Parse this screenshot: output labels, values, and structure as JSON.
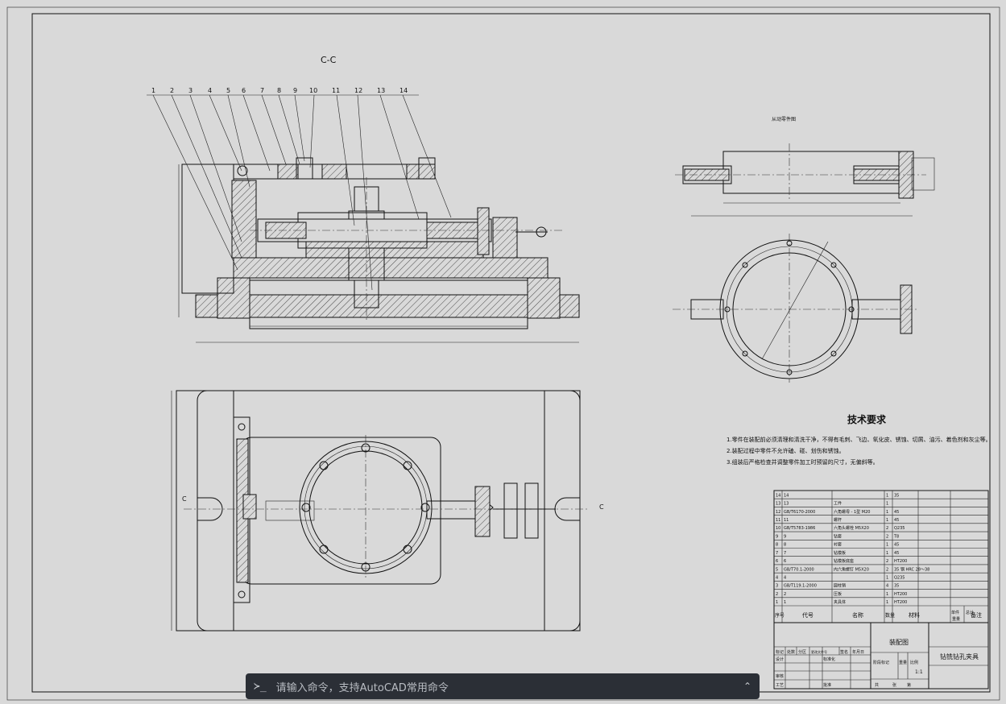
{
  "drawing": {
    "section_label": "C-C",
    "aux_view_label": "从动零件图",
    "tech_req_title": "技术要求",
    "tech_req_lines": [
      "1.零件在装配前必须清理和清洗干净，不得有毛刺、飞边、氧化皮、锈蚀、切屑、油污、着色剂和灰尘等。",
      "2.装配过程中零件不允许磕、碰、划伤和锈蚀。",
      "3.组装后严格检查并调整零件加工时预留的尺寸，无偏斜等。"
    ],
    "balloons": [
      "1",
      "2",
      "3",
      "4",
      "5",
      "6",
      "7",
      "8",
      "9",
      "10",
      "11",
      "12",
      "13",
      "14"
    ],
    "section_marks": [
      "C",
      "C"
    ]
  },
  "bom": {
    "rows": [
      {
        "no": "14",
        "code": "14",
        "name": "",
        "qty": "1",
        "material": "35"
      },
      {
        "no": "13",
        "code": "13",
        "name": "工件",
        "qty": "1",
        "material": ""
      },
      {
        "no": "12",
        "code": "GB/T6170-2000",
        "name": "六角螺母 - 1型 M20",
        "qty": "1",
        "material": "45"
      },
      {
        "no": "11",
        "code": "11",
        "name": "螺杆",
        "qty": "1",
        "material": "45"
      },
      {
        "no": "10",
        "code": "GB/T5783-1986",
        "name": "六角头螺栓 M5X20",
        "qty": "2",
        "material": "Q235"
      },
      {
        "no": "9",
        "code": "9",
        "name": "钻套",
        "qty": "2",
        "material": "T8"
      },
      {
        "no": "8",
        "code": "8",
        "name": "衬套",
        "qty": "1",
        "material": "45"
      },
      {
        "no": "7",
        "code": "7",
        "name": "钻模板",
        "qty": "1",
        "material": "45"
      },
      {
        "no": "6",
        "code": "6",
        "name": "钻模板底座",
        "qty": "2",
        "material": "HT200"
      },
      {
        "no": "5",
        "code": "GB/T70.1-2000",
        "name": "内六角螺钉 M5X20",
        "qty": "2",
        "material": "35 钢 HRC 28～38"
      },
      {
        "no": "4",
        "code": "4",
        "name": "",
        "qty": "1",
        "material": "Q235"
      },
      {
        "no": "3",
        "code": "GB/T119.1-2000",
        "name": "圆柱销",
        "qty": "4",
        "material": "35"
      },
      {
        "no": "2",
        "code": "2",
        "name": "压板",
        "qty": "1",
        "material": "HT200"
      },
      {
        "no": "1",
        "code": "1",
        "name": "夹具体",
        "qty": "1",
        "material": "HT200"
      }
    ],
    "header": {
      "no": "序号",
      "code": "代号",
      "name": "名称",
      "qty": "数量",
      "material": "材料",
      "unit_weight": "单件",
      "total_weight": "总计",
      "weight": "重量",
      "remark": "备注"
    }
  },
  "title_block": {
    "drawing_name": "装配图",
    "part_title": "钻铣钻孔夹具",
    "scale": "1:1",
    "labels": {
      "mark": "标记",
      "count": "处数",
      "zone": "分区",
      "change_doc": "更改文件号",
      "signature": "签名",
      "date": "年月日",
      "design": "设计",
      "standardize": "标准化",
      "stage_mark": "阶段标记",
      "weight": "重量",
      "ratio": "比例",
      "check": "审核",
      "craft": "工艺",
      "approve": "批准",
      "total": "共",
      "sheet": "张",
      "page": "第"
    }
  },
  "command_line": {
    "prompt_icon": "terminal-icon",
    "prompt_glyph": "≻_",
    "placeholder": "请输入命令，支持AutoCAD常用命令",
    "collapse_icon": "chevron-up-icon",
    "collapse_glyph": "⌃"
  },
  "colors": {
    "background": "#d9d9d9",
    "line": "#111111",
    "command_bar": "#2b2f36",
    "command_text": "#b8bcc2"
  }
}
